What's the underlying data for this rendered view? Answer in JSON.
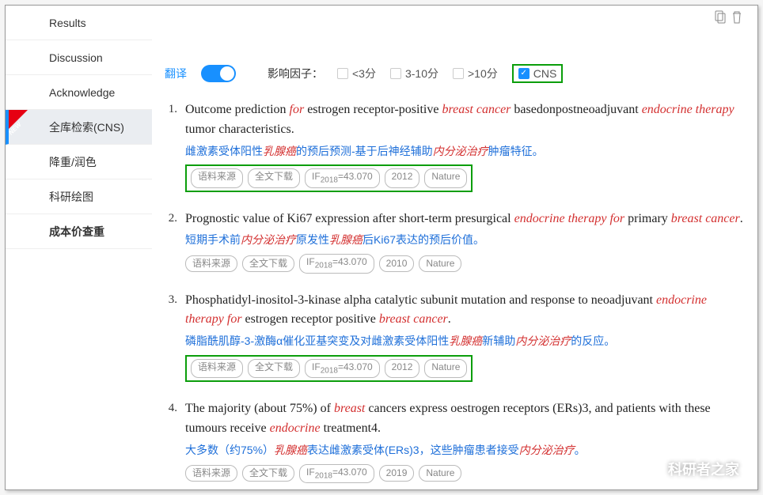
{
  "sidebar": {
    "items": [
      {
        "label": "Results"
      },
      {
        "label": "Discussion"
      },
      {
        "label": "Acknowledge"
      },
      {
        "label": "全库检索(CNS)",
        "active": true,
        "new": true
      },
      {
        "label": "降重/润色"
      },
      {
        "label": "科研绘图"
      },
      {
        "label": "成本价查重",
        "bold": true
      }
    ]
  },
  "filter": {
    "translate_label": "翻译",
    "if_label": "影响因子：",
    "opts": [
      "<3分",
      "3-10分",
      ">10分"
    ],
    "cns_label": "CNS"
  },
  "results": [
    {
      "num": "1.",
      "title": "Outcome prediction <i>for</i> estrogen receptor-positive <i>breast cancer</i> basedonpostneoadjuvant <i>endocrine therapy</i> tumor characteristics.",
      "trans": "雌激素受体阳性<i>乳腺癌</i>的预后预测-基于后神经辅助<i>内分泌治疗</i>肿瘤特征。",
      "tags": [
        "语料来源",
        "全文下载",
        "IF2018=43.070",
        "2012",
        "Nature"
      ],
      "box": true
    },
    {
      "num": "2.",
      "title": "Prognostic value of Ki67 expression after short-term presurgical <i>endocrine therapy for</i> primary <i>breast cancer</i>.",
      "trans": "短期手术前<i>内分泌治疗</i>原发性<i>乳腺癌</i>后Ki67表达的预后价值。",
      "tags": [
        "语料来源",
        "全文下载",
        "IF2018=43.070",
        "2010",
        "Nature"
      ],
      "box": false
    },
    {
      "num": "3.",
      "title": "Phosphatidyl-inositol-3-kinase alpha catalytic subunit mutation and response to neoadjuvant <i>endocrine therapy for</i> estrogen receptor positive <i>breast cancer</i>.",
      "trans": "磷脂酰肌醇-3-激酶α催化亚基突变及对雌激素受体阳性<i>乳腺癌</i>新辅助<i>内分泌治疗</i>的反应。",
      "tags": [
        "语料来源",
        "全文下载",
        "IF2018=43.070",
        "2012",
        "Nature"
      ],
      "box": true
    },
    {
      "num": "4.",
      "title": "The majority (about 75%) of <i>breast</i> cancers express oestrogen receptors (ERs)3, and patients with these tumours receive <i>endocrine</i> treatment4.",
      "trans": "大多数（约75%）<i>乳腺癌</i>表达雌激素受体(ERs)3，这些肿瘤患者接受<i>内分泌治疗</i>。",
      "tags": [
        "语料来源",
        "全文下载",
        "IF2018=43.070",
        "2019",
        "Nature"
      ],
      "box": false
    }
  ],
  "watermark": "科研者之家"
}
